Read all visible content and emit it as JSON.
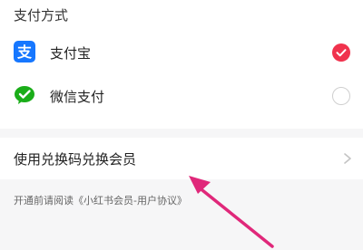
{
  "payment": {
    "section_title": "支付方式",
    "options": [
      {
        "label": "支付宝",
        "icon": "alipay-icon",
        "selected": true,
        "brand_color": "#1677ff"
      },
      {
        "label": "微信支付",
        "icon": "wechat-pay-icon",
        "selected": false,
        "brand_color": "#1aad19"
      }
    ],
    "selected_color": "#f0324d"
  },
  "redeem": {
    "label": "使用兑换码兑换会员",
    "icon": "chevron-right-icon"
  },
  "agreement": {
    "text": "开通前请阅读《小红书会员-用户协议》"
  },
  "annotation": {
    "icon": "arrow-annotation-icon",
    "color": "#e0287a"
  }
}
